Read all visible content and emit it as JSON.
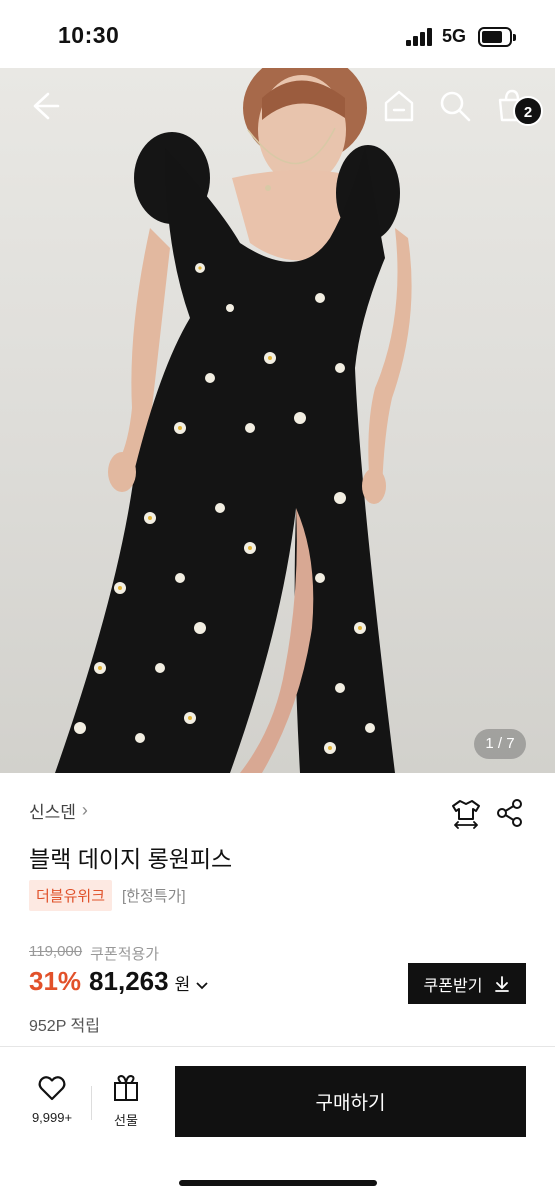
{
  "status_bar": {
    "time": "10:30",
    "network": "5G"
  },
  "hero": {
    "icons": [
      "back-arrow-icon",
      "home-icon",
      "search-icon",
      "shopping-bag-icon"
    ],
    "cart_count": "2",
    "page_indicator": "1 / 7"
  },
  "product": {
    "brand": "신스덴",
    "title": "블랙 데이지 롱원피스",
    "tags": [
      "더블유위크",
      "[한정특가]"
    ],
    "original_price": "119,000",
    "coupon_price_label": "쿠폰적용가",
    "discount": "31%",
    "price": "81,263",
    "currency": "원",
    "points": "952P 적립",
    "coupon_button": "쿠폰받기"
  },
  "bottom_bar": {
    "like_count": "9,999+",
    "gift_label": "선물",
    "buy_label": "구매하기"
  },
  "colors": {
    "accent": "#e2512a",
    "tag_bg": "#fde9e2",
    "primary": "#111111"
  }
}
